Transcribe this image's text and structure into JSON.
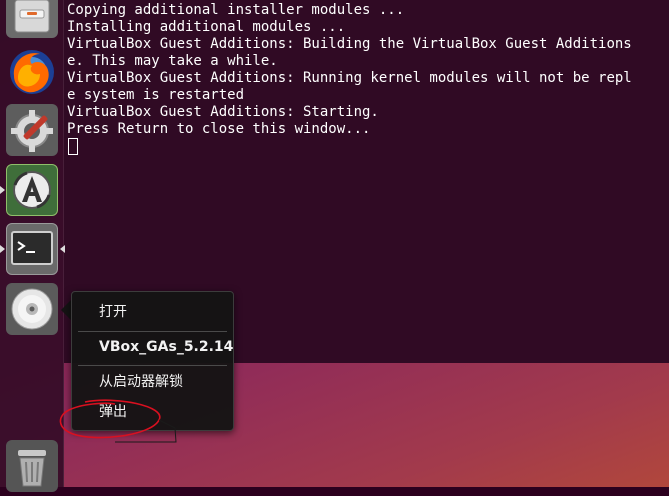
{
  "terminal": {
    "lines": [
      "Copying additional installer modules ...",
      "Installing additional modules ...",
      "VirtualBox Guest Additions: Building the VirtualBox Guest Additions",
      "e. This may take a while.",
      "VirtualBox Guest Additions: Running kernel modules will not be repl",
      "e system is restarted",
      "VirtualBox Guest Additions: Starting.",
      "Press Return to close this window..."
    ]
  },
  "launcher": {
    "items": [
      {
        "name": "files",
        "icon": "file-cabinet-icon"
      },
      {
        "name": "firefox",
        "icon": "firefox-icon"
      },
      {
        "name": "system-settings",
        "icon": "settings-gear-wrench-icon"
      },
      {
        "name": "software-updater",
        "icon": "software-updater-icon"
      },
      {
        "name": "terminal",
        "icon": "terminal-icon"
      },
      {
        "name": "vbox-gas-disc",
        "icon": "optical-disc-icon"
      },
      {
        "name": "trash",
        "icon": "trash-icon"
      }
    ]
  },
  "quicklist": {
    "open": "打开",
    "title": "VBox_GAs_5.2.14",
    "unlock": "从启动器解锁",
    "eject": "弹出"
  },
  "colors": {
    "terminal_bg": "#300a24",
    "annotation": "#d91020"
  }
}
